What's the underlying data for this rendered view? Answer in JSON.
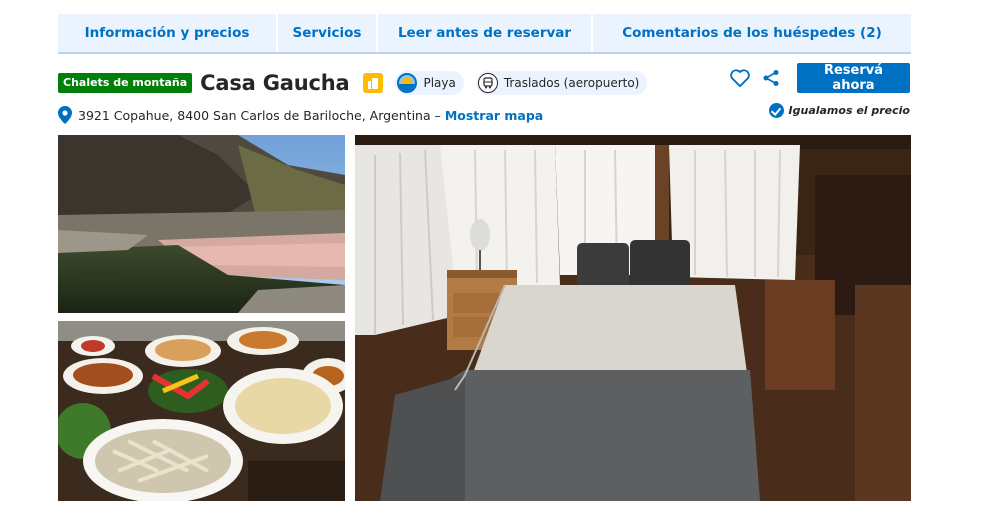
{
  "tabs": [
    {
      "label": "Información y precios"
    },
    {
      "label": "Servicios"
    },
    {
      "label": "Leer antes de reservar"
    },
    {
      "label": "Comentarios de los huéspedes (2)"
    }
  ],
  "property": {
    "type_badge": "Chalets de montaña",
    "name": "Casa Gaucha",
    "chips": [
      {
        "icon": "beach-icon",
        "label": "Playa"
      },
      {
        "icon": "shuttle-icon",
        "label": "Traslados (aeropuerto)"
      }
    ],
    "address": "3921 Copahue, 8400 San Carlos de Bariloche, Argentina –",
    "map_link": "Mostrar mapa"
  },
  "actions": {
    "reserve_label": "Reservá ahora",
    "price_match": "Igualamos el precio"
  },
  "photos": [
    {
      "name": "river-photo"
    },
    {
      "name": "food-photo"
    },
    {
      "name": "bedroom-photo"
    }
  ],
  "colors": {
    "accent": "#0071c2",
    "badge": "#008009",
    "tab_bg": "#ebf3ff",
    "thumb": "#febb02"
  }
}
